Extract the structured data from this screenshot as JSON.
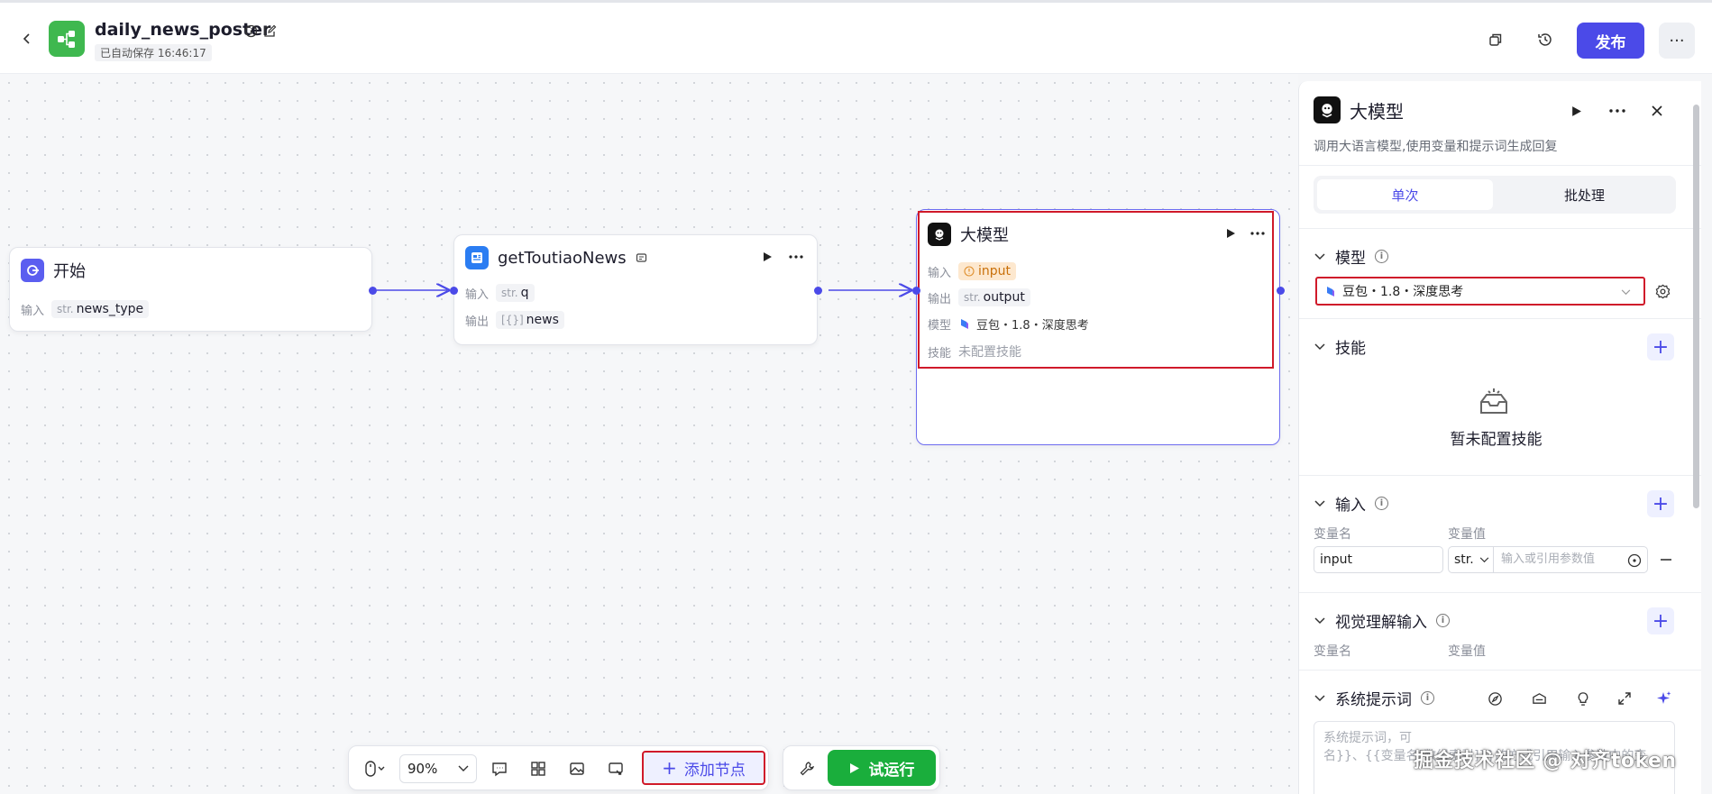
{
  "header": {
    "title": "daily_news_poster",
    "autosave": "已自动保存 16:46:17",
    "publish_label": "发布",
    "more_label": "···"
  },
  "canvas": {
    "nodes": [
      {
        "title": "开始",
        "rows": [
          {
            "label": "输入",
            "type": "str.",
            "value": "news_type"
          }
        ]
      },
      {
        "title": "getToutiaoNews",
        "rows": [
          {
            "label": "输入",
            "type": "str.",
            "value": "q"
          },
          {
            "label": "输出",
            "type": "[{}]",
            "value": "news"
          }
        ]
      },
      {
        "title": "大模型",
        "rows": [
          {
            "label": "输入",
            "value": "input"
          },
          {
            "label": "输出",
            "type": "str.",
            "value": "output"
          },
          {
            "label": "模型",
            "value": "豆包・1.8・深度思考"
          },
          {
            "label": "技能",
            "value": "未配置技能"
          }
        ]
      }
    ]
  },
  "toolbar": {
    "zoom": "90%",
    "add_node_label": "添加节点",
    "run_label": "试运行"
  },
  "panel": {
    "title": "大模型",
    "description": "调用大语言模型,使用变量和提示词生成回复",
    "tabs": [
      "单次",
      "批处理"
    ],
    "model_section": "模型",
    "model_value": "豆包・1.8・深度思考",
    "skills_section": "技能",
    "skills_empty": "暂未配置技能",
    "input_section": "输入",
    "var_name_label": "变量名",
    "var_value_label": "变量值",
    "input_var_name": "input",
    "input_var_type": "str.",
    "input_var_placeholder": "输入或引用参数值",
    "vision_section": "视觉理解输入",
    "system_prompt_section": "系统提示词",
    "system_prompt_placeholder_1": "系统提示词，可",
    "system_prompt_placeholder_2": "名}}、{{变量名[数组索引]}}的方式引用输入参数中的变"
  },
  "watermark": "掘金技术社区 @ 对齐token",
  "colors": {
    "accent": "#4b4ae8",
    "run_green": "#1aae3c",
    "highlight_red": "#d01a2a",
    "logo_green": "#3fb84f"
  }
}
